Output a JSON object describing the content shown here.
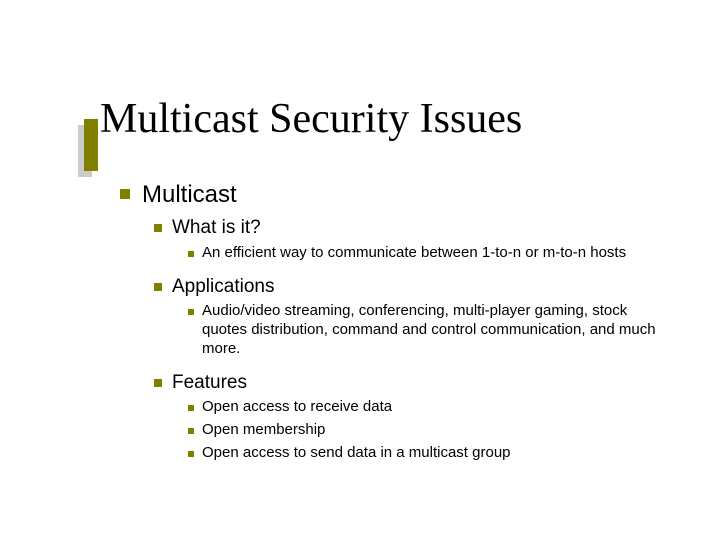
{
  "title": "Multicast Security Issues",
  "l1": {
    "multicast": "Multicast"
  },
  "l2": {
    "what_is_it": "What is it?",
    "applications": "Applications",
    "features": "Features"
  },
  "l3": {
    "efficient": "An efficient way to communicate between 1-to-n or m-to-n hosts",
    "apps_list": "Audio/video streaming, conferencing, multi-player gaming, stock quotes distribution, command and control communication, and much more.",
    "feat_1": "Open access to receive data",
    "feat_2": "Open membership",
    "feat_3": "Open access to send data in a multicast group"
  },
  "colors": {
    "accent": "#808000",
    "shadow": "#cccccc"
  }
}
